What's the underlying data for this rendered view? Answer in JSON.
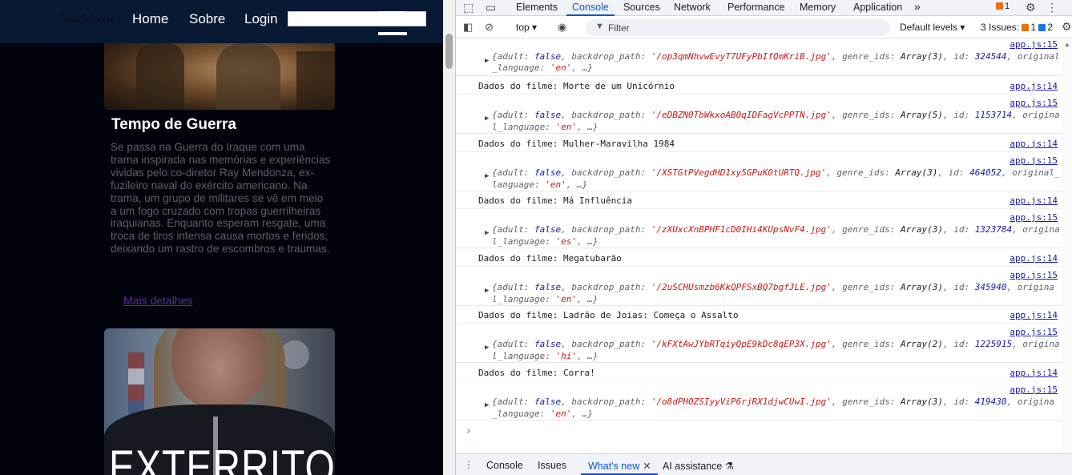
{
  "site": {
    "brand": "StarMovies",
    "nav": {
      "home": "Home",
      "about": "Sobre",
      "login": "Login"
    },
    "movie": {
      "title": "Tempo de Guerra",
      "description": "Se passa na Guerra do Iraque com uma trama inspirada nas memórias e experiências vividas pelo co-diretor Ray Mendonza, ex-fuzileiro naval do exército americano. Na trama, um grupo de militares se vê em meio a um fogo cruzado com tropas guerrilheiras iraquianas. Enquanto esperam resgate, uma troca de tiros intensa causa mortos e feridos, deixando um rastro de escombros e traumas.",
      "more_link": "Mais detalhes"
    },
    "next_poster_text": "EXTERRITORIAL"
  },
  "devtools": {
    "tabs": [
      "Elements",
      "Console",
      "Sources",
      "Network",
      "Performance",
      "Memory",
      "Application"
    ],
    "active_tab": "Console",
    "more_tabs": "»",
    "warnings_count": "1",
    "toolbar": {
      "context": "top",
      "filter_placeholder": "Filter",
      "levels": "Default levels",
      "issues_label": "3 Issues:",
      "issues_warn": "1",
      "issues_info": "2"
    },
    "console": {
      "first_object": {
        "source": "app.js:15",
        "line1_pre": "{adult: ",
        "adult": "false",
        "bp_key": ", backdrop_path: ",
        "bp": "'/op3qmNhvwEvyT7UFyPbIfQmKriB.jpg'",
        "genre_key": ", genre_ids: ",
        "genre": "Array(3)",
        "id_key": ", id: ",
        "id": "324544",
        "tail": ", original",
        "line2_pre": "_language: ",
        "lang": "'en'",
        "line2_post": ", …}"
      },
      "entries": [
        {
          "message": "Dados do filme: Morte de um Unicórnio",
          "msg_src": "app.js:14",
          "obj_src": "app.js:15",
          "adult": "false",
          "bp": "'/eDBZN0TbWkxoAB0qIDFagVcPPTN.jpg'",
          "genre": "Array(5)",
          "id": "1153714",
          "tail": ", origina",
          "l2": "l_language: ",
          "lang": "'en'"
        },
        {
          "message": "Dados do filme: Mulher-Maravilha 1984",
          "msg_src": "app.js:14",
          "obj_src": "app.js:15",
          "adult": "false",
          "bp": "'/XSTGtPVegdHD1xy5GPuK0tURTQ.jpg'",
          "genre": "Array(3)",
          "id": "464052",
          "tail": ", original_",
          "l2": "language: ",
          "lang": "'en'"
        },
        {
          "message": "Dados do filme: Má Influência",
          "msg_src": "app.js:14",
          "obj_src": "app.js:15",
          "adult": "false",
          "bp": "'/zXUxcXnBPHF1cD0IHi4KUpsNvF4.jpg'",
          "genre": "Array(3)",
          "id": "1323784",
          "tail": ", origina",
          "l2": "l_language: ",
          "lang": "'es'"
        },
        {
          "message": "Dados do filme: Megatubarão",
          "msg_src": "app.js:14",
          "obj_src": "app.js:15",
          "adult": "false",
          "bp": "'/2uSCHUsmzb6KkQPFSxBQ7bgfJLE.jpg'",
          "genre": "Array(3)",
          "id": "345940",
          "tail": ", origina",
          "l2": "l_language: ",
          "lang": "'en'"
        },
        {
          "message": "Dados do filme: Ladrão de Joias: Começa o Assalto",
          "msg_src": "app.js:14",
          "obj_src": "app.js:15",
          "adult": "false",
          "bp": "'/kFXtAwJYbRTqiyQpE9kDc8qEP3X.jpg'",
          "genre": "Array(2)",
          "id": "1225915",
          "tail": ", origina",
          "l2": "l_language: ",
          "lang": "'hi'"
        },
        {
          "message": "Dados do filme: Corra!",
          "msg_src": "app.js:14",
          "obj_src": "app.js:15",
          "adult": "false",
          "bp": "'/o8dPH0ZSIyyViP6rjRX1djwCUwI.jpg'",
          "genre": "Array(3)",
          "id": "419430",
          "tail": ", origina",
          "l2": "_language: ",
          "lang": "'en'"
        }
      ],
      "prompt": "›"
    },
    "drawer": {
      "tabs": [
        "Console",
        "Issues",
        "What's new",
        "AI assistance"
      ],
      "active": "What's new"
    }
  }
}
